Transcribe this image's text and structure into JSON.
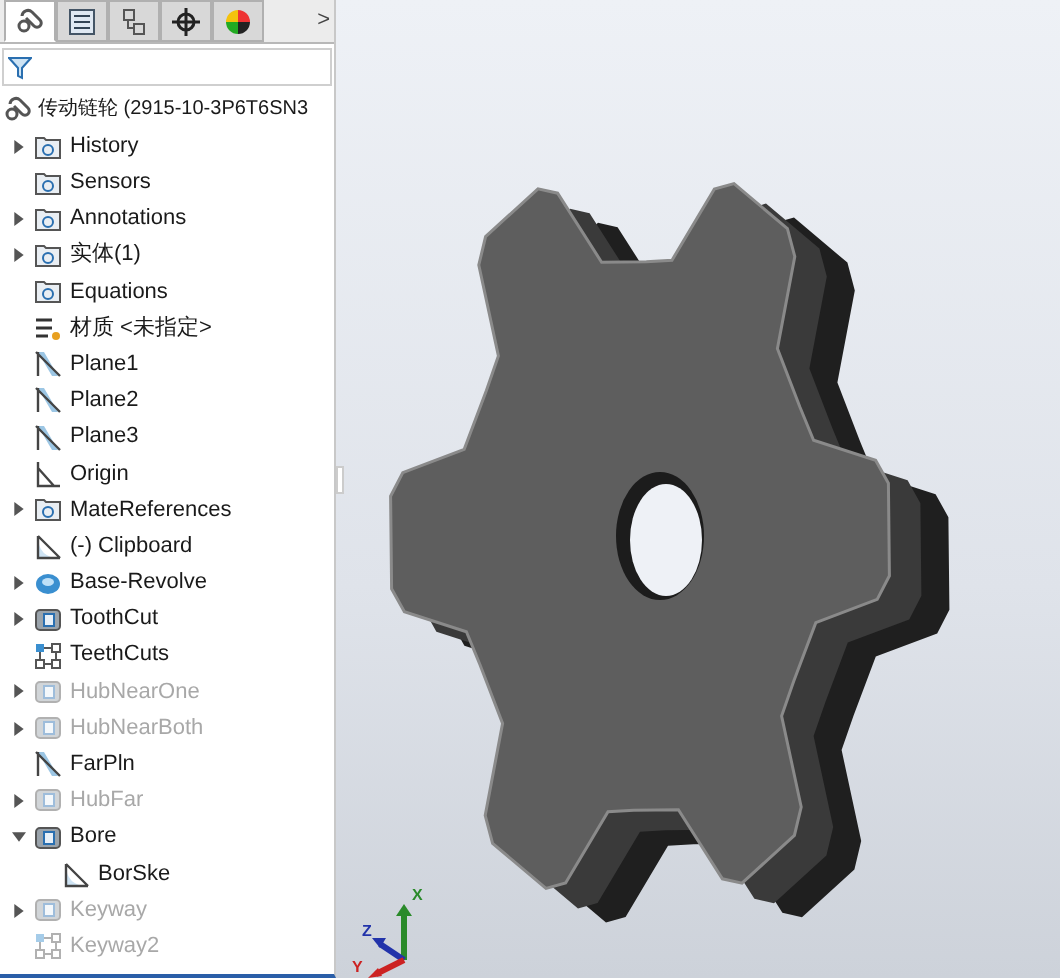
{
  "tabs": [
    {
      "kind": "feature",
      "selected": true
    },
    {
      "kind": "property",
      "selected": false
    },
    {
      "kind": "config",
      "selected": false
    },
    {
      "kind": "dimxpert",
      "selected": false
    },
    {
      "kind": "display",
      "selected": false
    }
  ],
  "more_tabs": ">",
  "root": {
    "label": "传动链轮 (2915-10-3P6T6SN3",
    "children": [
      {
        "label": "History",
        "kind": "folder",
        "expanded": false,
        "suppressed": false
      },
      {
        "label": "Sensors",
        "kind": "folder",
        "suppressed": false
      },
      {
        "label": "Annotations",
        "kind": "folder",
        "expanded": false,
        "suppressed": false
      },
      {
        "label": "实体(1)",
        "kind": "folder",
        "expanded": false,
        "suppressed": false
      },
      {
        "label": "Equations",
        "kind": "folder",
        "suppressed": false
      },
      {
        "label": "材质 <未指定>",
        "kind": "material",
        "suppressed": false
      },
      {
        "label": "Plane1",
        "kind": "plane",
        "suppressed": false
      },
      {
        "label": "Plane2",
        "kind": "plane",
        "suppressed": false
      },
      {
        "label": "Plane3",
        "kind": "plane",
        "suppressed": false
      },
      {
        "label": "Origin",
        "kind": "origin",
        "suppressed": false
      },
      {
        "label": "MateReferences",
        "kind": "folder",
        "expanded": false,
        "suppressed": false
      },
      {
        "label": "(-) Clipboard",
        "kind": "sketch",
        "suppressed": false
      },
      {
        "label": "Base-Revolve",
        "kind": "revolve",
        "expanded": false,
        "suppressed": false
      },
      {
        "label": "ToothCut",
        "kind": "cut",
        "expanded": false,
        "suppressed": false
      },
      {
        "label": "TeethCuts",
        "kind": "pattern",
        "suppressed": false
      },
      {
        "label": "HubNearOne",
        "kind": "cut",
        "expanded": false,
        "suppressed": true
      },
      {
        "label": "HubNearBoth",
        "kind": "cut",
        "expanded": false,
        "suppressed": true
      },
      {
        "label": "FarPln",
        "kind": "plane",
        "suppressed": false
      },
      {
        "label": "HubFar",
        "kind": "cut",
        "expanded": false,
        "suppressed": true
      },
      {
        "label": "Bore",
        "kind": "cut",
        "expanded": true,
        "suppressed": false,
        "children": [
          {
            "label": "BorSke",
            "kind": "sketch",
            "suppressed": false
          }
        ]
      },
      {
        "label": "Keyway",
        "kind": "cut",
        "expanded": false,
        "suppressed": true
      },
      {
        "label": "Keyway2",
        "kind": "pattern",
        "suppressed": true
      }
    ]
  },
  "triad": {
    "axes": [
      "Z",
      "Y",
      "X"
    ]
  }
}
